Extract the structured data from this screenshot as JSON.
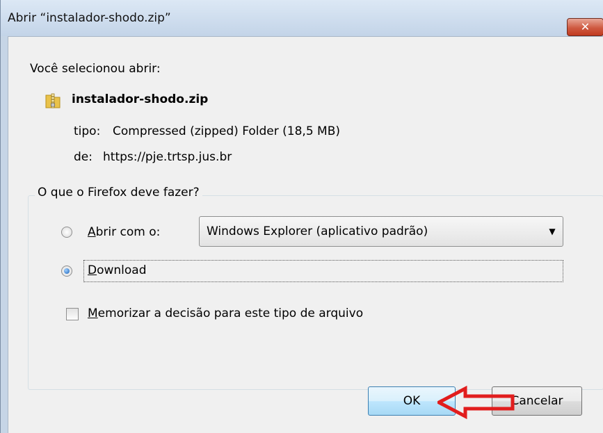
{
  "window": {
    "title": "Abrir “instalador-shodo.zip”",
    "close_glyph": "✕"
  },
  "dialog": {
    "intro": "Você selecionou abrir:",
    "file": {
      "icon": "zip-folder-icon",
      "name": "instalador-shodo.zip",
      "type_label": "tipo:",
      "type_value": "Compressed (zipped) Folder (18,5 MB)",
      "from_label": "de:",
      "from_value": "https://pje.trtsp.jus.br"
    },
    "group": {
      "legend": "O que o Firefox deve fazer?",
      "open_with": {
        "first": "A",
        "rest": "brir com o:",
        "selected": false,
        "app_value": "Windows Explorer (aplicativo padrão)"
      },
      "download": {
        "first": "D",
        "rest": "ownload",
        "selected": true
      },
      "remember": {
        "first": "M",
        "rest": "emorizar a decisão para este tipo de arquivo",
        "checked": false
      }
    },
    "buttons": {
      "ok": "OK",
      "cancel": "Cancelar"
    },
    "annotation": {
      "arrow_color": "#e11d1d"
    }
  }
}
